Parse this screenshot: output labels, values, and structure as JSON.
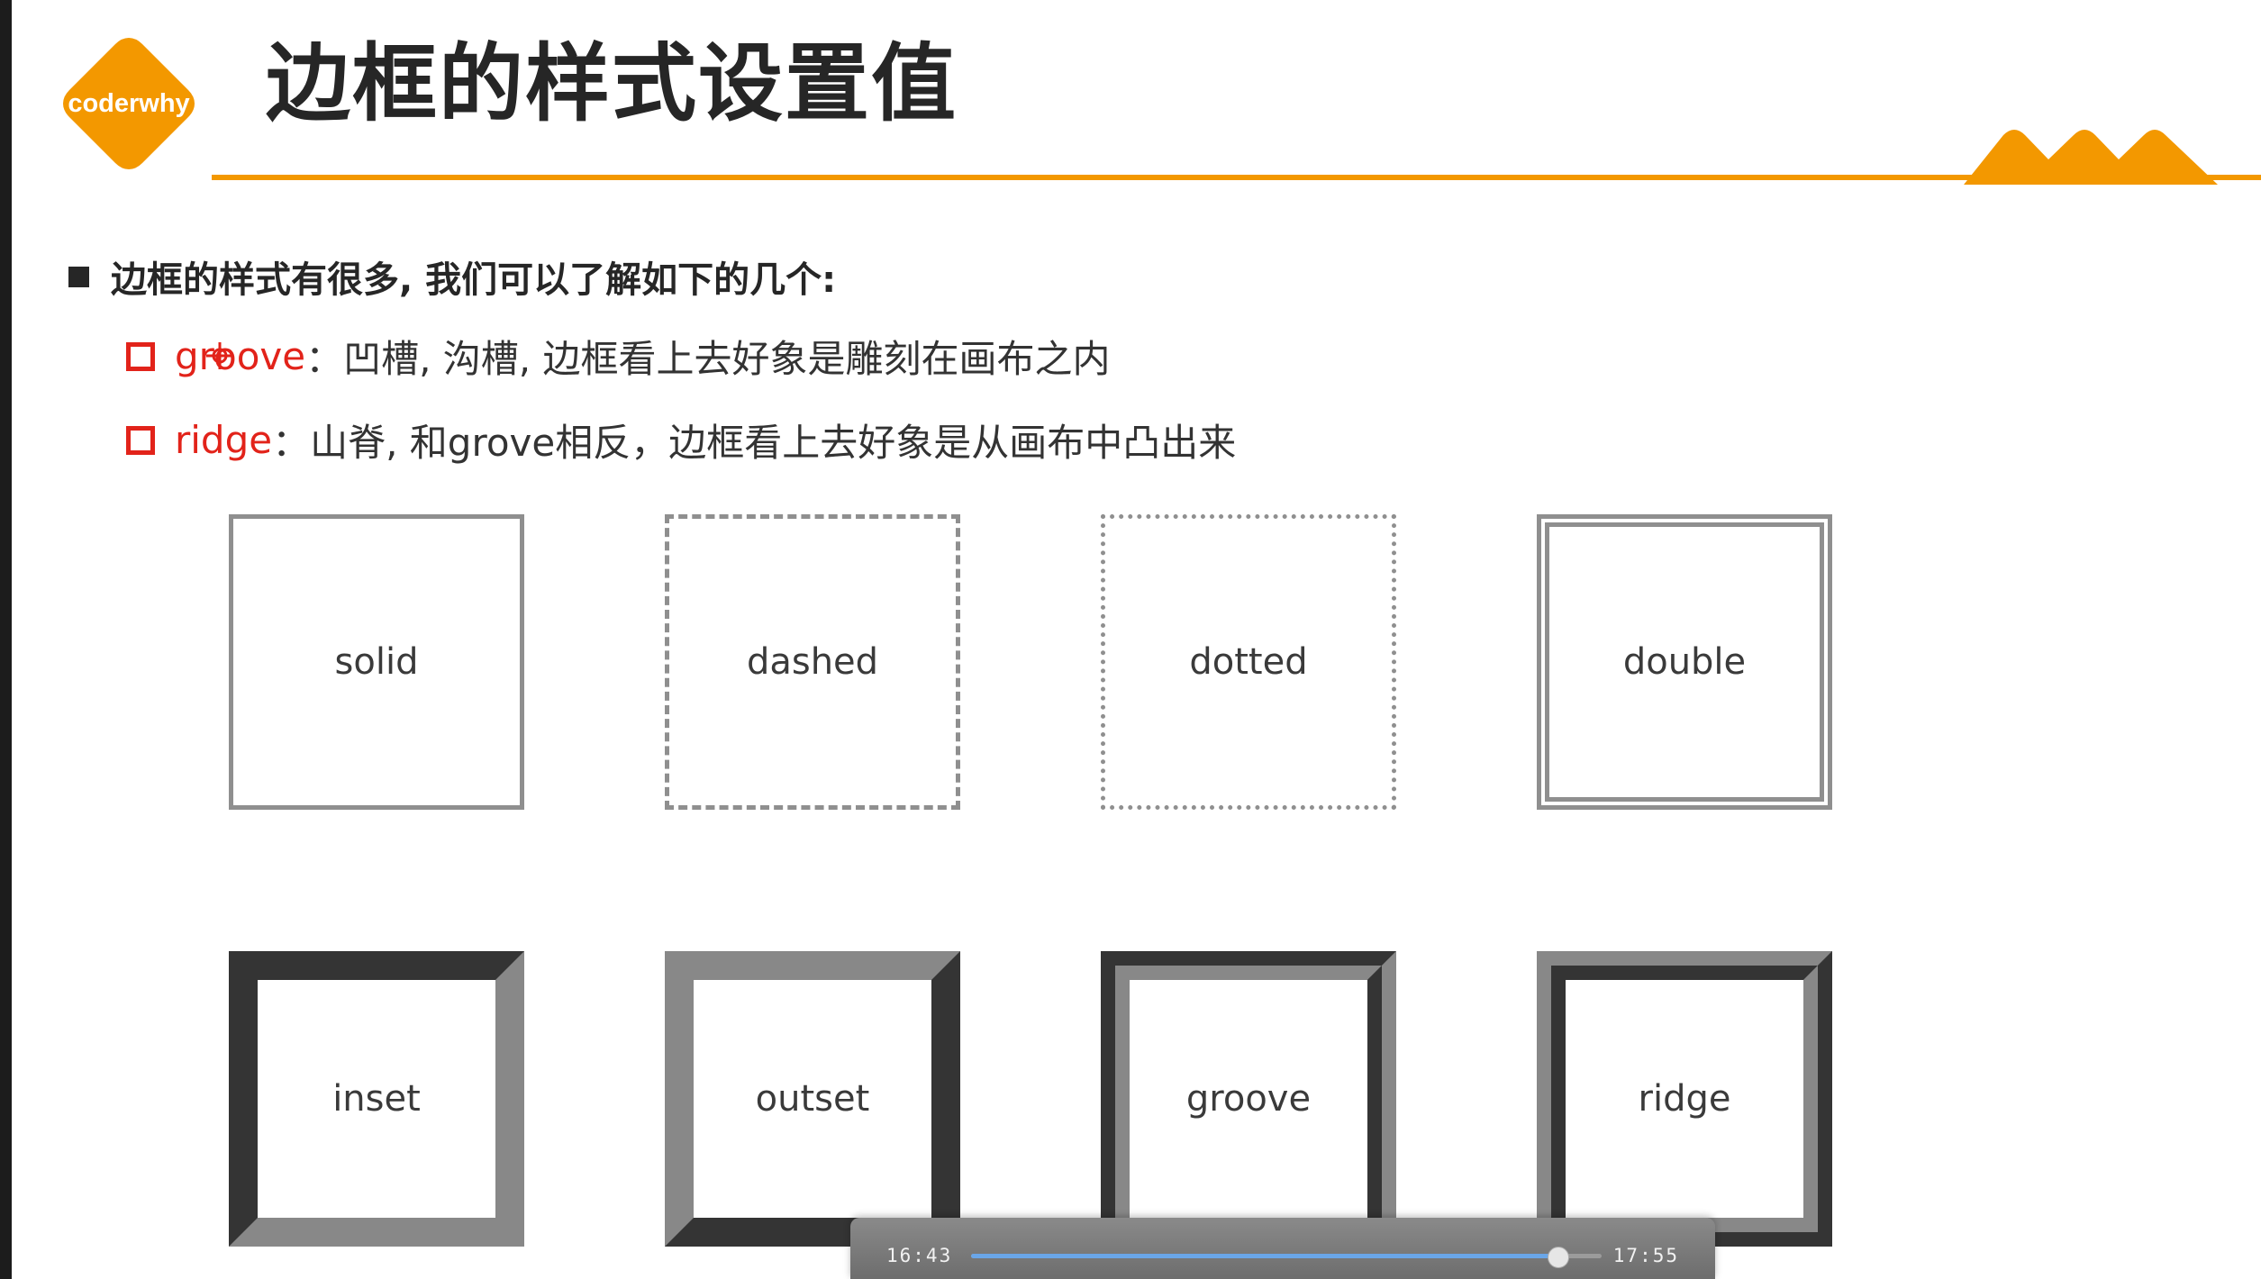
{
  "logo": {
    "text": "coderwhy",
    "color": "#f39800"
  },
  "title": "边框的样式设置值",
  "main_bullet": "边框的样式有很多, 我们可以了解如下的几个:",
  "items": [
    {
      "keyword": "groove",
      "desc": "：凹槽, 沟槽, 边框看上去好象是雕刻在画布之内"
    },
    {
      "keyword": "ridge",
      "desc": "：山脊, 和grove相反，边框看上去好象是从画布中凸出来"
    }
  ],
  "demos": [
    {
      "label": "solid"
    },
    {
      "label": "dashed"
    },
    {
      "label": "dotted"
    },
    {
      "label": "double"
    },
    {
      "label": "inset"
    },
    {
      "label": "outset"
    },
    {
      "label": "groove"
    },
    {
      "label": "ridge"
    }
  ],
  "player": {
    "current": "16:43",
    "total": "17:55",
    "progress": 0.93
  },
  "colors": {
    "accent": "#f39800",
    "bullet_red": "#e2231a",
    "demo_border": "#8f8f8f",
    "player_bar": "#6aa6e8"
  }
}
